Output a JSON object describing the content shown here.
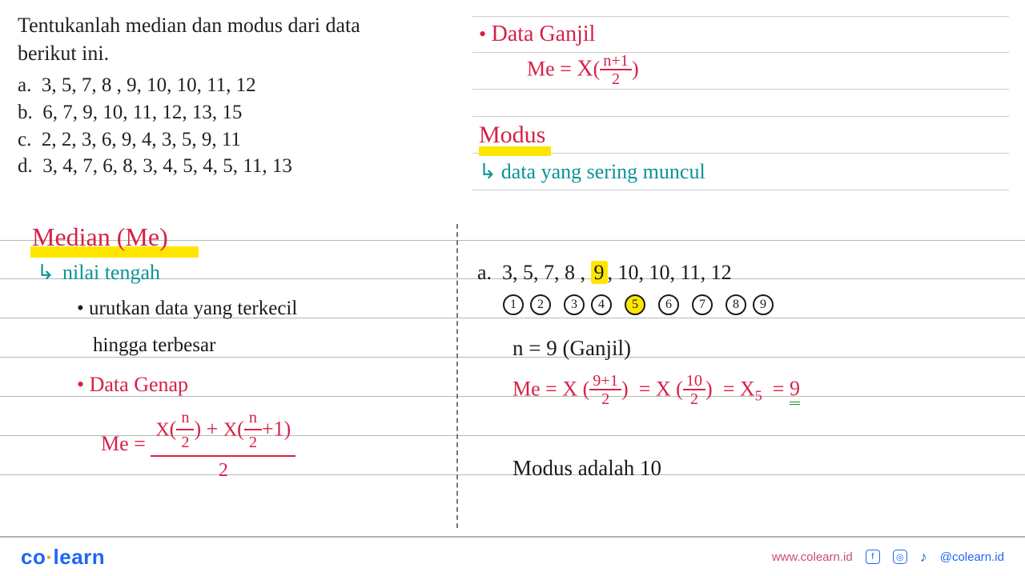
{
  "question": {
    "prompt": "Tentukanlah median dan modus dari data berikut ini.",
    "items": {
      "a": "3, 5, 7, 8 , 9, 10, 10, 11, 12",
      "b": "6, 7, 9, 10, 11, 12, 13, 15",
      "c": "2, 2, 3, 6, 9, 4, 3, 5, 9, 11",
      "d": "3, 4, 7, 6, 8, 3, 4, 5, 4, 5, 11, 13"
    }
  },
  "left": {
    "median_heading": "Median (Me)",
    "subtitle": "nilai tengah",
    "arrow": "↳",
    "bullet1a": "urutkan data yang terkecil",
    "bullet1b": "hingga terbesar",
    "data_genap": "Data Genap",
    "me_eq": "Me =",
    "x_label": "X",
    "n2": "n",
    "n2d": "2",
    "plus1": "+1",
    "denom": "2"
  },
  "right": {
    "data_ganjil": "Data Ganjil",
    "me_eq": "Me =",
    "x_label": "X",
    "np1": "n+1",
    "two": "2",
    "modus": "Modus",
    "arrow": "↳",
    "modus_def": "data yang sering muncul",
    "a_label": "a.",
    "sorted": "3, 5, 7, 8 ,",
    "mid": "9",
    "sorted_rest": ", 10, 10, 11, 12",
    "nums": [
      "1",
      "2",
      "3",
      "4",
      "5",
      "6",
      "7",
      "8",
      "9"
    ],
    "n_eq": "n = 9 (Ganjil)",
    "me_line": {
      "me": "Me =",
      "x": "X",
      "f1n": "9+1",
      "f1d": "2",
      "eq2": "=",
      "f2n": "10",
      "f2d": "2",
      "eq3": "= X",
      "sub5": "5",
      "eq4": "=",
      "ans": "9"
    },
    "modus_ans": "Modus adalah 10"
  },
  "footer": {
    "brand_a": "co",
    "brand_dot": "·",
    "brand_b": "learn",
    "url": "www.colearn.id",
    "handle": "@colearn.id"
  }
}
